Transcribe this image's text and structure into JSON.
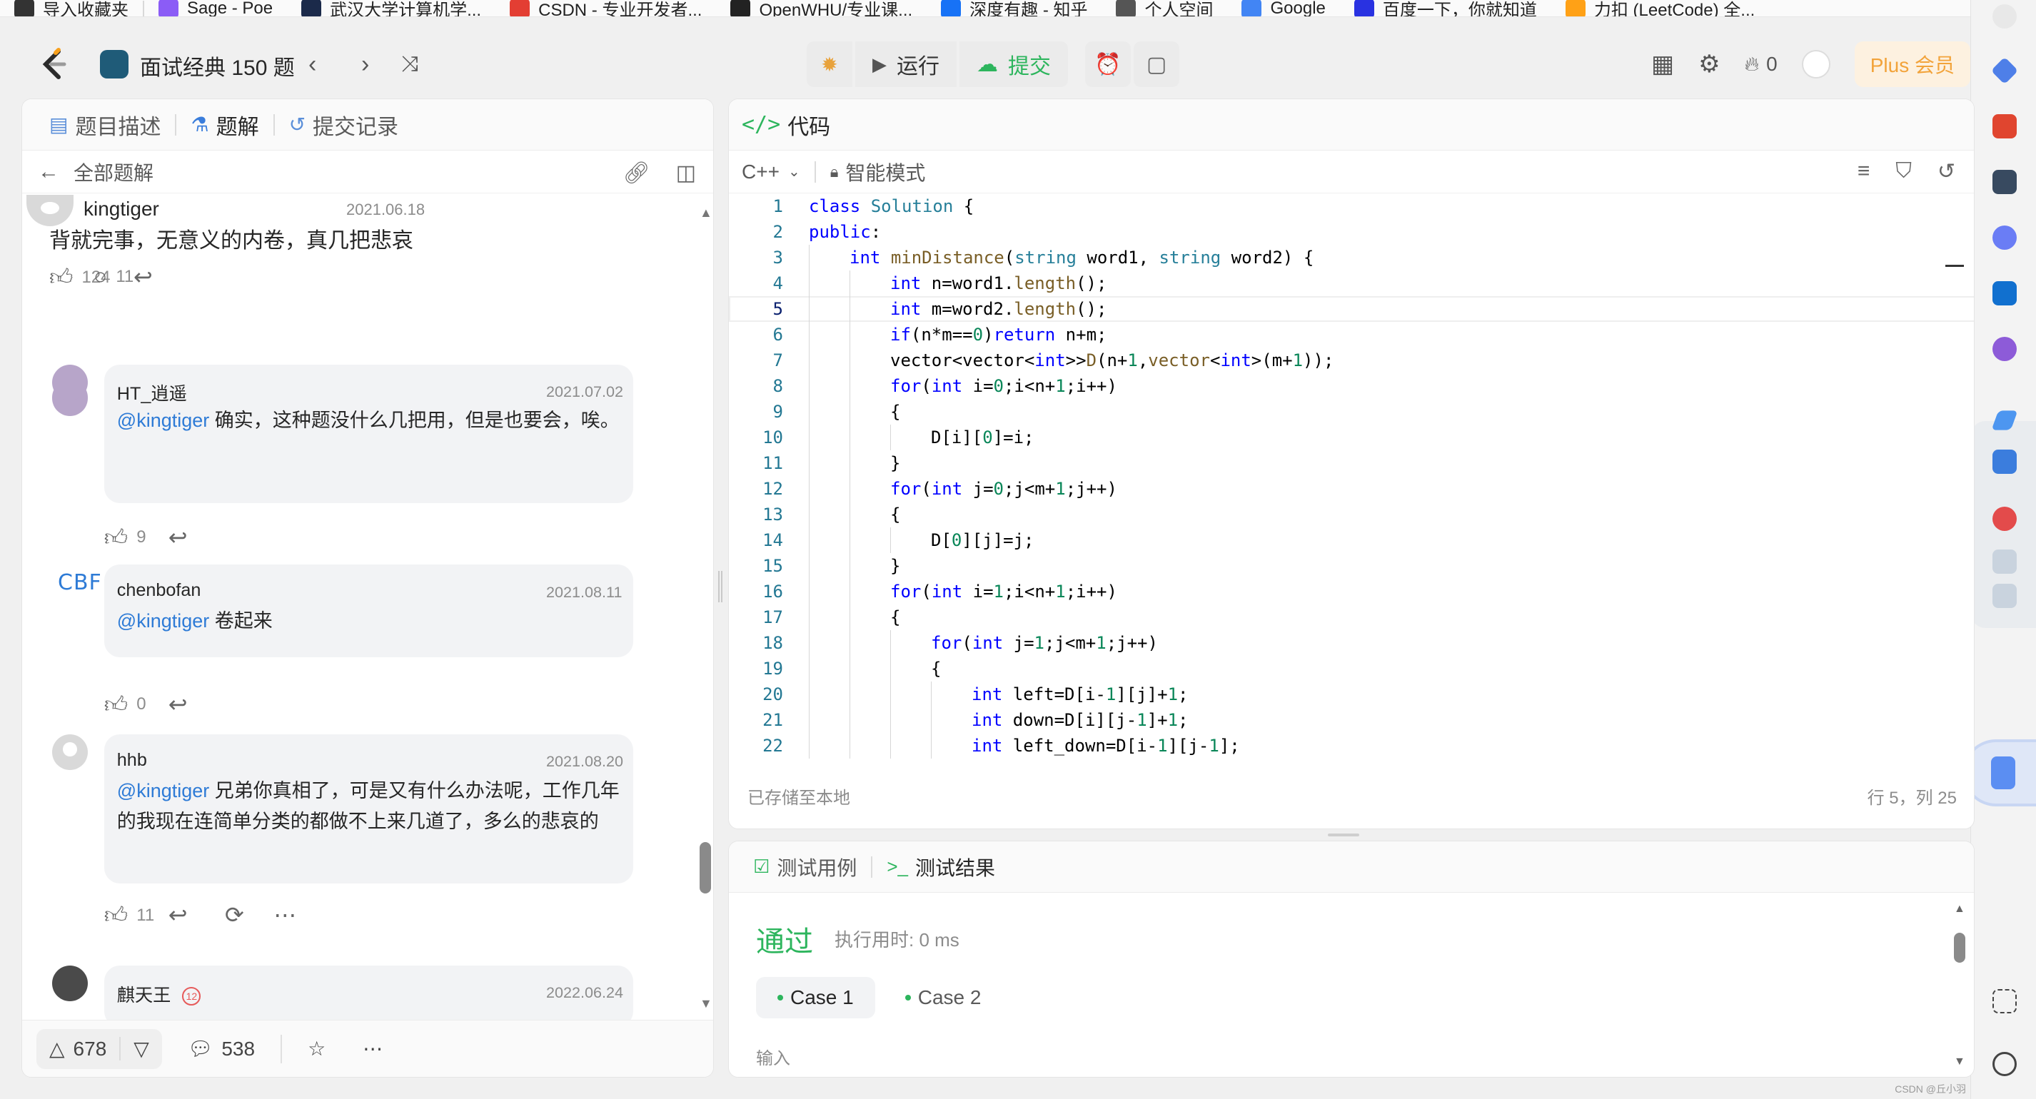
{
  "bookmarks": [
    {
      "label": "导入收藏夹",
      "color": "#333333"
    },
    {
      "label": "Sage - Poe",
      "color": "#8b5cf6"
    },
    {
      "label": "武汉大学计算机学...",
      "color": "#1b2a4a"
    },
    {
      "label": "CSDN - 专业开发者...",
      "color": "#e33e33"
    },
    {
      "label": "OpenWHU/专业课...",
      "color": "#222222"
    },
    {
      "label": "深度有趣 - 知乎",
      "color": "#1772f6"
    },
    {
      "label": "个人空间",
      "color": "#555555"
    },
    {
      "label": "Google",
      "color": "#4285f4"
    },
    {
      "label": "百度一下，你就知道",
      "color": "#2932e1"
    },
    {
      "label": "力扣 (LeetCode) 全...",
      "color": "#ffa116"
    }
  ],
  "header": {
    "list_title": "面试经典 150 题",
    "run_label": "运行",
    "submit_label": "提交",
    "streak_count": "0",
    "plus_label": "Plus 会员"
  },
  "left": {
    "tabs": [
      {
        "label": "题目描述"
      },
      {
        "label": "题解"
      },
      {
        "label": "提交记录"
      }
    ],
    "back_label": "全部题解",
    "main_comment": {
      "user": "kingtiger",
      "date": "2021.06.18",
      "text": "背就完事，无意义的内卷，真几把悲哀",
      "likes": "124",
      "replies": "11"
    },
    "replies": [
      {
        "user": "HT_逍遥",
        "date": "2021.07.02",
        "mention": "@kingtiger",
        "text": " 确实，这种题没什么几把用，但是也要会，唉。",
        "likes": "9"
      },
      {
        "user": "chenbofan",
        "avatar_text": "CBF",
        "date": "2021.08.11",
        "mention": "@kingtiger",
        "text": " 卷起来",
        "likes": "0"
      },
      {
        "user": "hhb",
        "date": "2021.08.20",
        "mention": "@kingtiger",
        "text": " 兄弟你真相了，可是又有什么办法呢，工作几年的我现在连简单分类的都做不上来几道了，多么的悲哀的",
        "likes": "11"
      },
      {
        "user": "麒天王",
        "date": "2022.06.24",
        "level": "12"
      }
    ],
    "footer": {
      "upvotes": "678",
      "comments": "538"
    }
  },
  "code": {
    "header_label": "代码",
    "language": "C++",
    "mode": "智能模式",
    "status_left": "已存储至本地",
    "status_right": "行 5，列 25",
    "current_line": 5,
    "lines": [
      {
        "n": "1",
        "indent": 0,
        "html": "<span class=\"kw\">class</span> <span class=\"ty\">Solution</span> {"
      },
      {
        "n": "2",
        "indent": 0,
        "html": "<span class=\"kw\">public</span>:"
      },
      {
        "n": "3",
        "indent": 1,
        "html": "<span class=\"kw\">int</span> <span class=\"fn\">minDistance</span>(<span class=\"ty\">string</span> word1, <span class=\"ty\">string</span> word2) {"
      },
      {
        "n": "4",
        "indent": 2,
        "html": "<span class=\"kw\">int</span> n=word1.<span class=\"fn\">length</span>();"
      },
      {
        "n": "5",
        "indent": 2,
        "html": "<span class=\"kw\">int</span> m=word2.<span class=\"fn\">length</span>();"
      },
      {
        "n": "6",
        "indent": 2,
        "html": "<span class=\"kw\">if</span>(n*m==<span class=\"num\">0</span>)<span class=\"kw\">return</span> n+m;"
      },
      {
        "n": "7",
        "indent": 2,
        "html": "vector&lt;vector&lt;<span class=\"kw\">int</span>&gt;&gt;<span class=\"fn\">D</span>(n+<span class=\"num\">1</span>,<span class=\"fn\">vector</span>&lt;<span class=\"kw\">int</span>&gt;(m+<span class=\"num\">1</span>));"
      },
      {
        "n": "8",
        "indent": 2,
        "html": "<span class=\"kw\">for</span>(<span class=\"kw\">int</span> i=<span class=\"num\">0</span>;i&lt;n+<span class=\"num\">1</span>;i++)"
      },
      {
        "n": "9",
        "indent": 2,
        "html": "{"
      },
      {
        "n": "10",
        "indent": 3,
        "html": "D[i][<span class=\"num\">0</span>]=i;"
      },
      {
        "n": "11",
        "indent": 2,
        "html": "}"
      },
      {
        "n": "12",
        "indent": 2,
        "html": "<span class=\"kw\">for</span>(<span class=\"kw\">int</span> j=<span class=\"num\">0</span>;j&lt;m+<span class=\"num\">1</span>;j++)"
      },
      {
        "n": "13",
        "indent": 2,
        "html": "{"
      },
      {
        "n": "14",
        "indent": 3,
        "html": "D[<span class=\"num\">0</span>][j]=j;"
      },
      {
        "n": "15",
        "indent": 2,
        "html": "}"
      },
      {
        "n": "16",
        "indent": 2,
        "html": "<span class=\"kw\">for</span>(<span class=\"kw\">int</span> i=<span class=\"num\">1</span>;i&lt;n+<span class=\"num\">1</span>;i++)"
      },
      {
        "n": "17",
        "indent": 2,
        "html": "{"
      },
      {
        "n": "18",
        "indent": 3,
        "html": "<span class=\"kw\">for</span>(<span class=\"kw\">int</span> j=<span class=\"num\">1</span>;j&lt;m+<span class=\"num\">1</span>;j++)"
      },
      {
        "n": "19",
        "indent": 3,
        "html": "{"
      },
      {
        "n": "20",
        "indent": 4,
        "html": "<span class=\"kw\">int</span> left=D[i-<span class=\"num\">1</span>][j]+<span class=\"num\">1</span>;"
      },
      {
        "n": "21",
        "indent": 4,
        "html": "<span class=\"kw\">int</span> down=D[i][j-<span class=\"num\">1</span>]+<span class=\"num\">1</span>;"
      },
      {
        "n": "22",
        "indent": 4,
        "html": "<span class=\"kw\">int</span> left_down=D[i-<span class=\"num\">1</span>][j-<span class=\"num\">1</span>];"
      }
    ]
  },
  "test": {
    "tab_cases": "测试用例",
    "tab_result": "测试结果",
    "status": "通过",
    "runtime": "执行用时: 0 ms",
    "cases": [
      "Case 1",
      "Case 2"
    ],
    "input_label": "输入"
  },
  "watermark": "CSDN @丘小羽"
}
